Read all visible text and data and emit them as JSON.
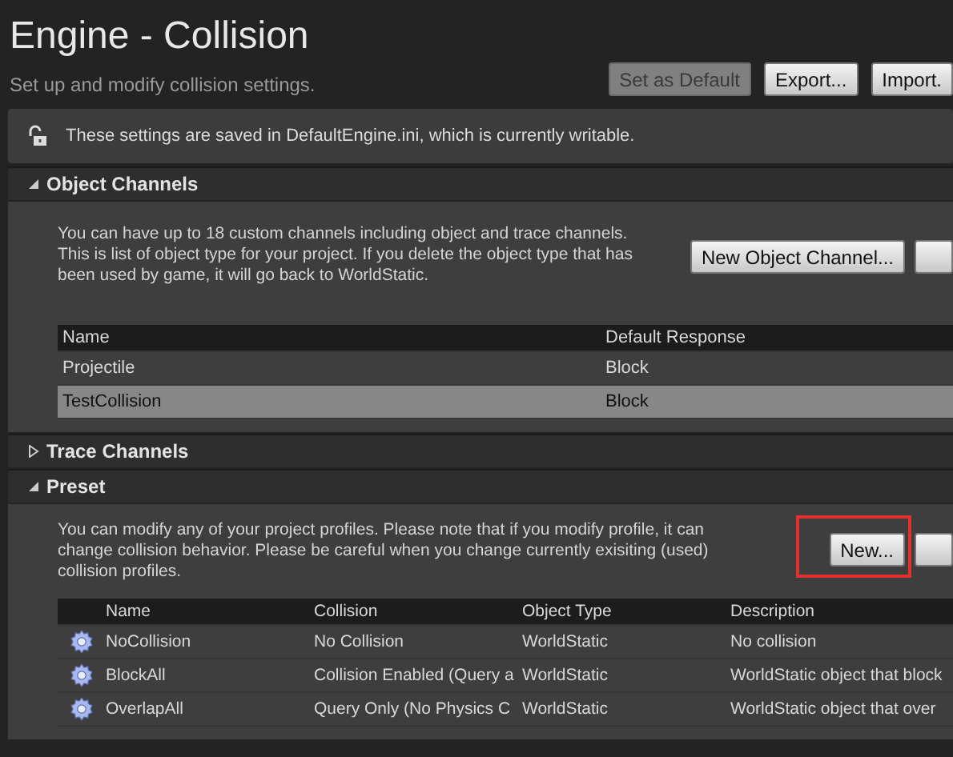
{
  "header": {
    "title": "Engine - Collision",
    "subtitle": "Set up and modify collision settings.",
    "buttons": [
      {
        "label": "Set as Default",
        "disabled": true
      },
      {
        "label": "Export...",
        "disabled": false
      },
      {
        "label": "Import.",
        "disabled": false
      }
    ]
  },
  "notice": {
    "locked": false,
    "text": "These settings are saved in DefaultEngine.ini, which is currently writable."
  },
  "sections": [
    {
      "title": "Object Channels",
      "expanded": true,
      "description": "You can have up to 18 custom channels including object and trace channels. This is list of object type for your project. If you delete the object type that has been used by game, it will go back to WorldStatic.",
      "buttons": [
        {
          "label": "New Object Channel...",
          "highlighted": false
        },
        {
          "highlighted": false
        }
      ],
      "table": {
        "kind": "channels",
        "columns": [
          "Name",
          "Default Response"
        ],
        "rows": [
          {
            "cells": [
              "Projectile",
              "Block"
            ],
            "selected": false
          },
          {
            "cells": [
              "TestCollision",
              "Block"
            ],
            "selected": true
          }
        ]
      }
    },
    {
      "title": "Trace Channels",
      "expanded": false
    },
    {
      "title": "Preset",
      "expanded": true,
      "description": "You can modify any of your project profiles. Please note that if you modify profile, it can change collision behavior. Please be careful when you change currently exisiting (used) collision profiles.",
      "buttons": [
        {
          "label": "New...",
          "highlighted": true
        },
        {
          "highlighted": false
        }
      ],
      "table": {
        "kind": "profiles",
        "columns": [
          "Name",
          "Collision",
          "Object Type",
          "Description"
        ],
        "rows": [
          {
            "cells": [
              "NoCollision",
              "No Collision",
              "WorldStatic",
              "No collision"
            ],
            "selected": false
          },
          {
            "cells": [
              "BlockAll",
              "Collision Enabled (Query a",
              "WorldStatic",
              "WorldStatic object that block"
            ],
            "selected": false
          },
          {
            "cells": [
              "OverlapAll",
              "Query Only (No Physics C",
              "WorldStatic",
              "WorldStatic object that over"
            ],
            "selected": false
          }
        ]
      }
    }
  ]
}
